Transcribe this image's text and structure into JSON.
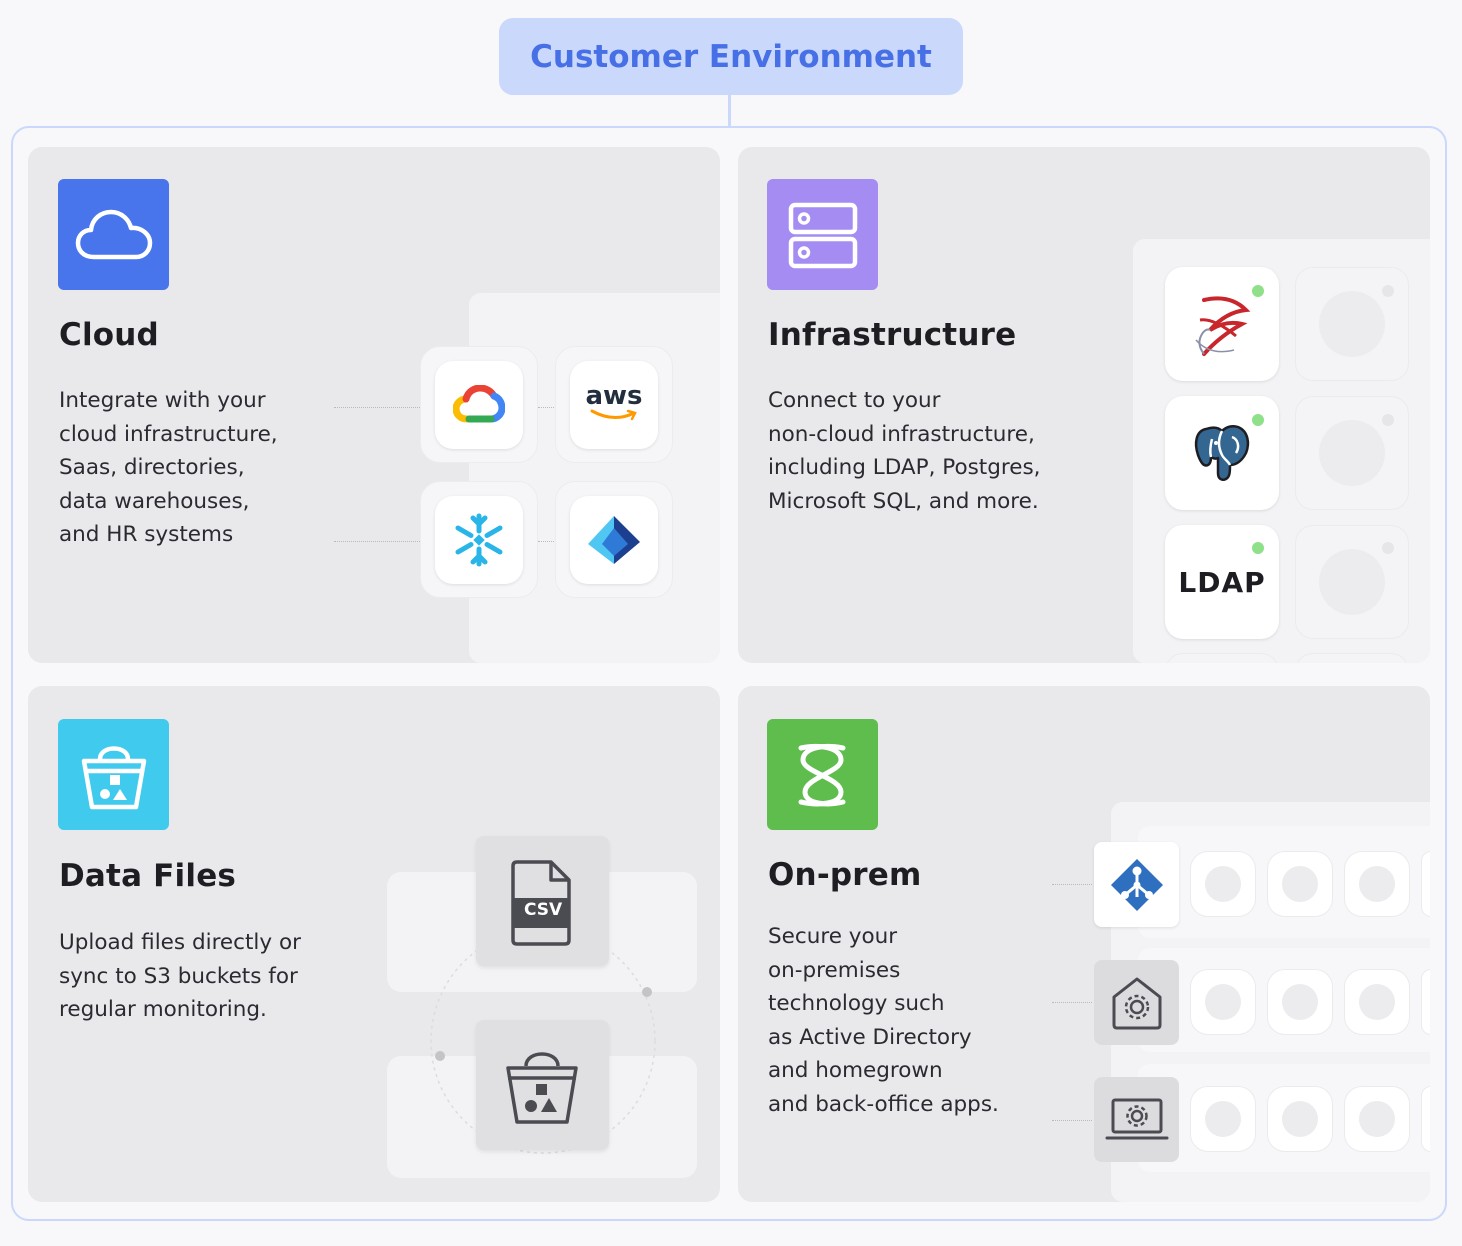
{
  "header": {
    "title": "Customer Environment"
  },
  "colors": {
    "title_bg": "#c9d8fb",
    "title_text": "#4770e6",
    "cloud_icon": "#4874ec",
    "infrastructure_icon": "#a58cf2",
    "data_files_icon": "#3fcaee",
    "on_prem_icon": "#5fbd4e",
    "status_dot": "#8fe089"
  },
  "cards": {
    "cloud": {
      "title": "Cloud",
      "description": "Integrate with your\ncloud infrastructure,\nSaas, directories,\ndata warehouses,\nand HR systems",
      "icon": "cloud-icon",
      "integrations": [
        "google-cloud-icon",
        "aws-icon",
        "snowflake-icon",
        "azure-icon"
      ],
      "aws_label": "aws"
    },
    "infrastructure": {
      "title": "Infrastructure",
      "description": "Connect to your\nnon-cloud infrastructure,\nincluding LDAP, Postgres,\nMicrosoft SQL, and more.",
      "icon": "server-icon",
      "integrations": [
        "microsoft-sql-icon",
        "postgres-icon",
        "ldap-icon"
      ],
      "ldap_label": "LDAP"
    },
    "data_files": {
      "title": "Data Files",
      "description": "Upload files directly or\nsync to S3 buckets for\nregular monitoring.",
      "icon": "bucket-icon",
      "items": [
        "csv-file-icon",
        "s3-bucket-icon"
      ],
      "csv_label": "CSV"
    },
    "on_prem": {
      "title": "On-prem",
      "description": "Secure your\non-premises\ntechnology such\nas Active Directory\nand homegrown\nand back-office apps.",
      "icon": "on-prem-icon",
      "items": [
        "active-directory-icon",
        "homegrown-app-icon",
        "back-office-app-icon"
      ]
    }
  }
}
